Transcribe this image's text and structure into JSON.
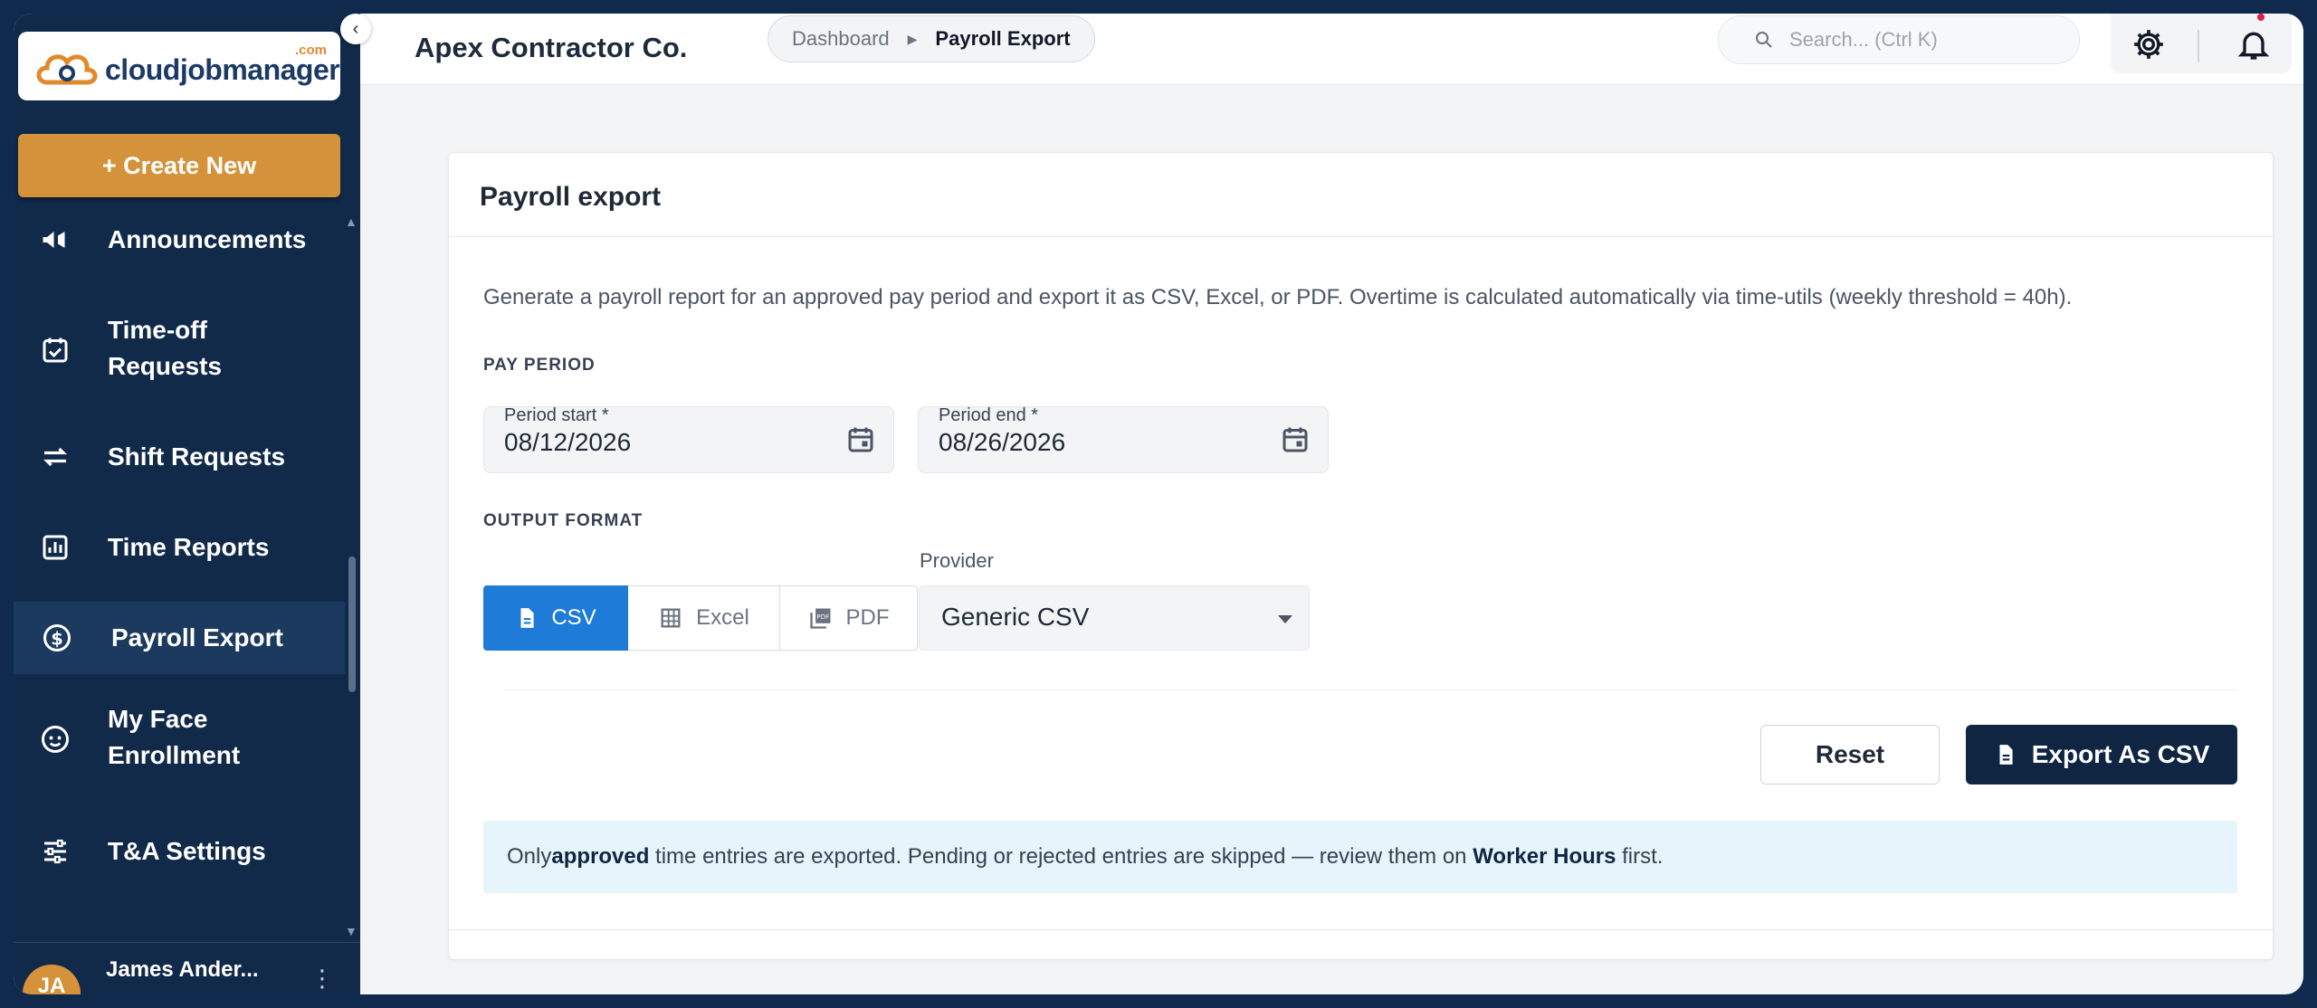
{
  "brand": {
    "name": "cloudjobmanager",
    "suffix": ".com"
  },
  "sidebar": {
    "create_label": "+ Create New",
    "items": [
      {
        "label": "Announcements",
        "icon": "megaphone-icon"
      },
      {
        "label": "Time-off\nRequests",
        "icon": "calendar-check-icon"
      },
      {
        "label": "Shift Requests",
        "icon": "swap-arrows-icon"
      },
      {
        "label": "Time Reports",
        "icon": "bar-chart-icon"
      },
      {
        "label": "Payroll Export",
        "icon": "dollar-circle-icon",
        "active": true
      },
      {
        "label": "My Face\nEnrollment",
        "icon": "face-icon"
      },
      {
        "label": "T&A Settings",
        "icon": "sliders-icon"
      }
    ],
    "user": {
      "initials": "JA",
      "name": "James Ander..."
    }
  },
  "header": {
    "company": "Apex Contractor Co.",
    "breadcrumb": [
      "Dashboard",
      "Payroll Export"
    ],
    "search_placeholder": "Search... (Ctrl K)"
  },
  "card": {
    "title": "Payroll export",
    "description": "Generate a payroll report for an approved pay period and export it as CSV, Excel, or PDF. Overtime is calculated automatically via time-utils (weekly threshold = 40h).",
    "pay_period_label": "PAY PERIOD",
    "period_start_label": "Period start *",
    "period_start_value": "08/12/2026",
    "period_end_label": "Period end *",
    "period_end_value": "08/26/2026",
    "output_format_label": "OUTPUT FORMAT",
    "formats": [
      "CSV",
      "Excel",
      "PDF"
    ],
    "selected_format": "CSV",
    "provider_label": "Provider",
    "provider_value": "Generic CSV",
    "reset_label": "Reset",
    "export_label": "Export As CSV",
    "notice": {
      "p1": "Only ",
      "b1": "approved",
      "p2": " time entries are exported. Pending or rejected entries are skipped — review them on ",
      "b2": "Worker Hours",
      "p3": " first."
    }
  },
  "colors": {
    "sidebar": "#112a4a",
    "accent": "#d4933a",
    "primary": "#1f7bd8",
    "dark_button": "#0f2542"
  }
}
